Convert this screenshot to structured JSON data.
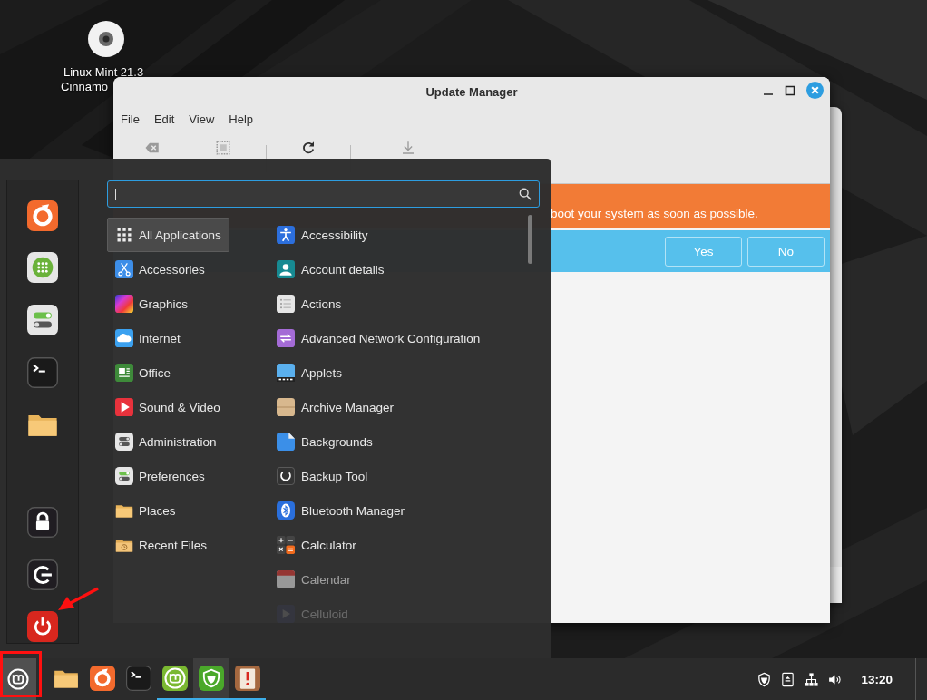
{
  "desktop": {
    "icon_label": [
      "Linux Mint 21.3",
      "Cinnamo"
    ]
  },
  "update_window": {
    "title": "Update Manager",
    "menu": [
      "File",
      "Edit",
      "View",
      "Help"
    ],
    "toolbar": [
      {
        "kind": "clear",
        "disabled": true
      },
      {
        "kind": "select-all",
        "disabled": true
      },
      {
        "kind": "refresh",
        "disabled": false
      },
      {
        "kind": "install",
        "disabled": true
      }
    ],
    "banner": "boot your system as soon as possible.",
    "prompt_buttons": [
      "Yes",
      "No"
    ]
  },
  "menu": {
    "favorites": [
      {
        "kind": "browser"
      },
      {
        "kind": "software"
      },
      {
        "kind": "settings"
      },
      {
        "kind": "terminal"
      },
      {
        "kind": "folder"
      },
      {
        "kind": "lock"
      },
      {
        "kind": "logout"
      },
      {
        "kind": "power"
      }
    ],
    "categories": [
      {
        "label": "All Applications",
        "kind": "all",
        "selected": true
      },
      {
        "label": "Accessories",
        "kind": "accessories",
        "selected": false
      },
      {
        "label": "Graphics",
        "kind": "graphics",
        "selected": false
      },
      {
        "label": "Internet",
        "kind": "internet",
        "selected": false
      },
      {
        "label": "Office",
        "kind": "office",
        "selected": false
      },
      {
        "label": "Sound & Video",
        "kind": "sound-video",
        "selected": false
      },
      {
        "label": "Administration",
        "kind": "administration",
        "selected": false
      },
      {
        "label": "Preferences",
        "kind": "preferences",
        "selected": false
      },
      {
        "label": "Places",
        "kind": "places",
        "selected": false
      },
      {
        "label": "Recent Files",
        "kind": "recent",
        "selected": false
      }
    ],
    "apps": [
      {
        "label": "Accessibility",
        "kind": "accessibility"
      },
      {
        "label": "Account details",
        "kind": "account"
      },
      {
        "label": "Actions",
        "kind": "actions"
      },
      {
        "label": "Advanced Network Configuration",
        "kind": "network"
      },
      {
        "label": "Applets",
        "kind": "applets"
      },
      {
        "label": "Archive Manager",
        "kind": "archive"
      },
      {
        "label": "Backgrounds",
        "kind": "backgrounds"
      },
      {
        "label": "Backup Tool",
        "kind": "backup"
      },
      {
        "label": "Bluetooth Manager",
        "kind": "bluetooth"
      },
      {
        "label": "Calculator",
        "kind": "calculator"
      },
      {
        "label": "Calendar",
        "kind": "calendar"
      },
      {
        "label": "Celluloid",
        "kind": "celluloid"
      }
    ]
  },
  "taskbar": {
    "launchers": [
      {
        "kind": "folder",
        "running": false,
        "selected": false
      },
      {
        "kind": "browser",
        "running": false,
        "selected": false
      },
      {
        "kind": "terminal",
        "running": false,
        "selected": false
      },
      {
        "kind": "mint-update",
        "running": true,
        "selected": false
      },
      {
        "kind": "shield",
        "running": true,
        "selected": true
      },
      {
        "kind": "update-manager",
        "running": true,
        "selected": false
      }
    ],
    "tray": [
      {
        "kind": "shield"
      },
      {
        "kind": "eject"
      },
      {
        "kind": "network"
      },
      {
        "kind": "volume"
      }
    ],
    "clock": "13:20"
  }
}
